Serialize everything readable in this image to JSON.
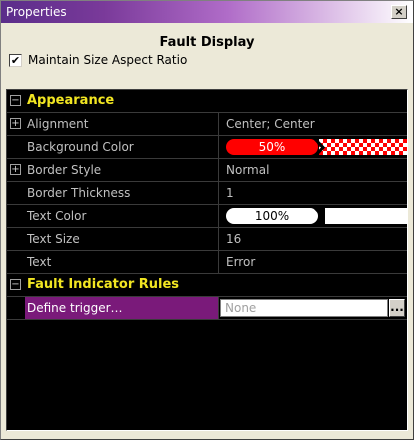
{
  "window": {
    "title": "Properties",
    "close_label": "×"
  },
  "header": {
    "title": "Fault Display",
    "maintain_label": "Maintain Size Aspect Ratio",
    "maintain_checked": true
  },
  "grid": {
    "appearance_label": "Appearance",
    "rows": [
      {
        "name": "Alignment",
        "value": "Center; Center",
        "expandable": true
      },
      {
        "name": "Background Color",
        "value": "50%",
        "expandable": false
      },
      {
        "name": "Border Style",
        "value": "Normal",
        "expandable": true
      },
      {
        "name": "Border Thickness",
        "value": "1",
        "expandable": false
      },
      {
        "name": "Text Color",
        "value": "100%",
        "expandable": false
      },
      {
        "name": "Text Size",
        "value": "16",
        "expandable": false
      },
      {
        "name": "Text",
        "value": "Error",
        "expandable": false
      }
    ],
    "fault_rules_label": "Fault Indicator Rules",
    "trigger": {
      "name": "Define trigger…",
      "value": "None",
      "button_label": "..."
    }
  },
  "colors": {
    "category_text": "#f2e622",
    "selection": "#7a1a7a",
    "background_fill": "#ff0000",
    "text_fill": "#ffffff"
  }
}
